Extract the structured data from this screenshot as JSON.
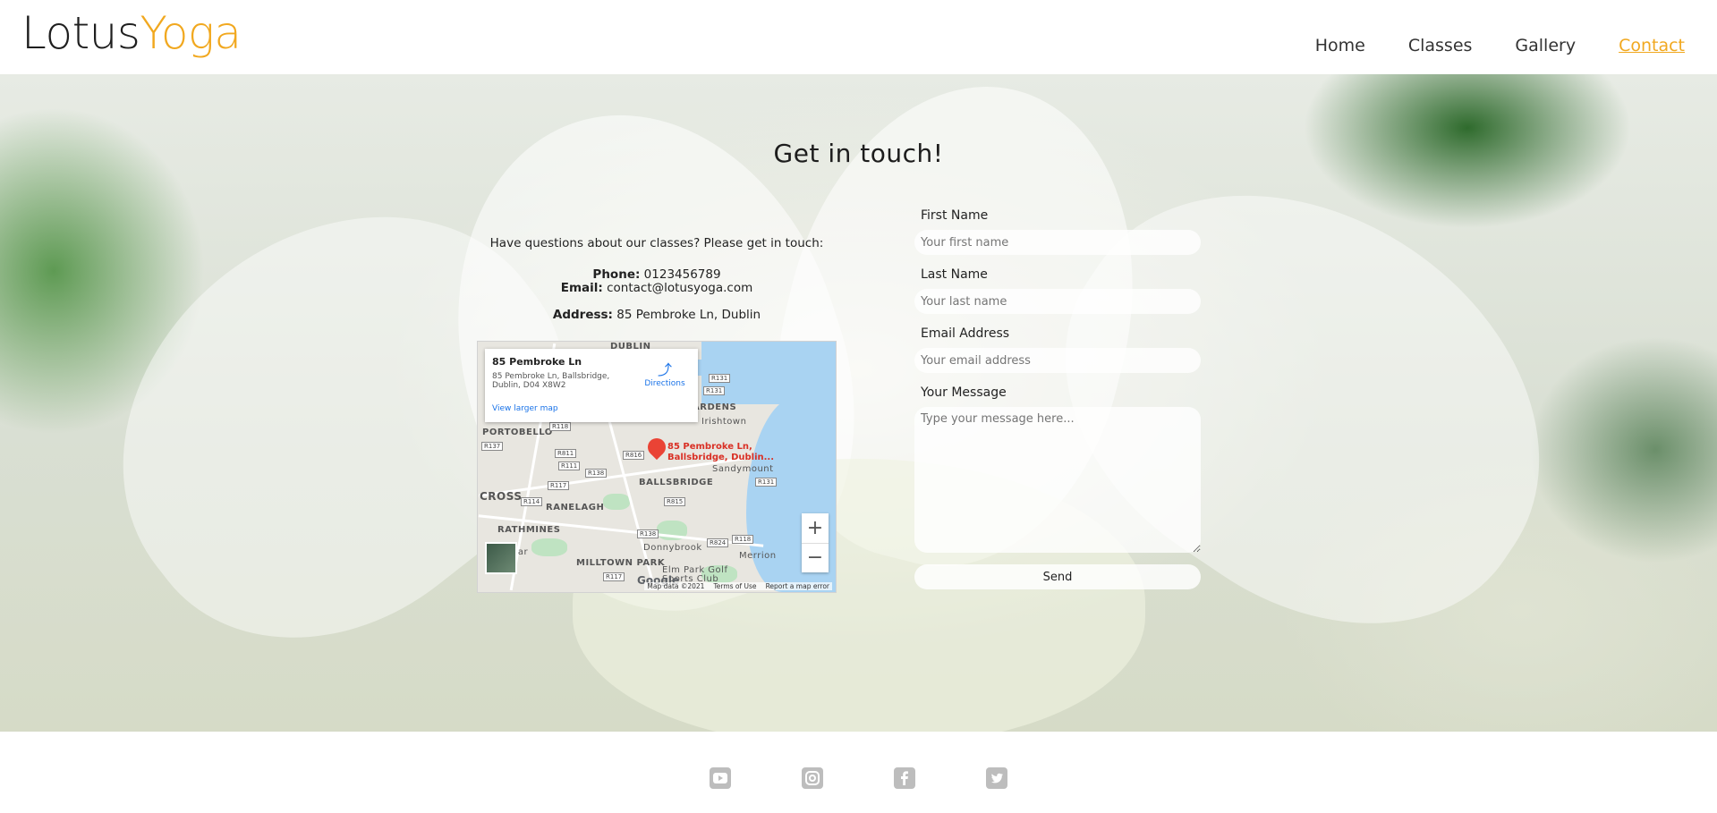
{
  "brand": {
    "part1": "Lotus",
    "part2": "Yoga",
    "accent": "#f1a81f"
  },
  "nav": {
    "items": [
      {
        "label": "Home"
      },
      {
        "label": "Classes"
      },
      {
        "label": "Gallery"
      },
      {
        "label": "Contact",
        "active": true
      }
    ]
  },
  "hero": {
    "title": "Get in touch!",
    "intro": "Have questions about our classes? Please get in touch:",
    "phone_label": "Phone:",
    "phone": "0123456789",
    "email_label": "Email:",
    "email": "contact@lotusyoga.com",
    "address_label": "Address:",
    "address": "85 Pembroke Ln, Dublin"
  },
  "map": {
    "place_title": "85 Pembroke Ln",
    "place_address": "85 Pembroke Ln, Ballsbridge, Dublin, D04 X8W2",
    "directions": "Directions",
    "larger_map": "View larger map",
    "pin_label_line1": "85 Pembroke Ln,",
    "pin_label_line2": "Ballsbridge, Dublin...",
    "area_labels": [
      "DUBLIN",
      "ARDENS",
      "Irishtown",
      "PORTOBELLO",
      "BALLSBRIDGE",
      "Sandymount",
      "CROSS",
      "RANELAGH",
      "RATHMINES",
      "Donnybrook",
      "Merrion",
      "MILLTOWN PARK",
      "Elm Park Golf",
      "Sports Club",
      "gar"
    ],
    "road_labels": [
      "R131",
      "R131",
      "R118",
      "R137",
      "R111",
      "R811",
      "R816",
      "R138",
      "R117",
      "R114",
      "R815",
      "R131",
      "R138",
      "R824",
      "R118",
      "R117"
    ],
    "zoom_in": "+",
    "zoom_out": "−",
    "google": "Google",
    "map_data": "Map data ©2021",
    "terms": "Terms of Use",
    "report": "Report a map error"
  },
  "form": {
    "first_name_label": "First Name",
    "first_name_placeholder": "Your first name",
    "last_name_label": "Last Name",
    "last_name_placeholder": "Your last name",
    "email_label": "Email Address",
    "email_placeholder": "Your email address",
    "message_label": "Your Message",
    "message_placeholder": "Type your message here...",
    "send_label": "Send"
  },
  "footer": {
    "social": [
      "youtube-icon",
      "instagram-icon",
      "facebook-icon",
      "twitter-icon"
    ]
  }
}
